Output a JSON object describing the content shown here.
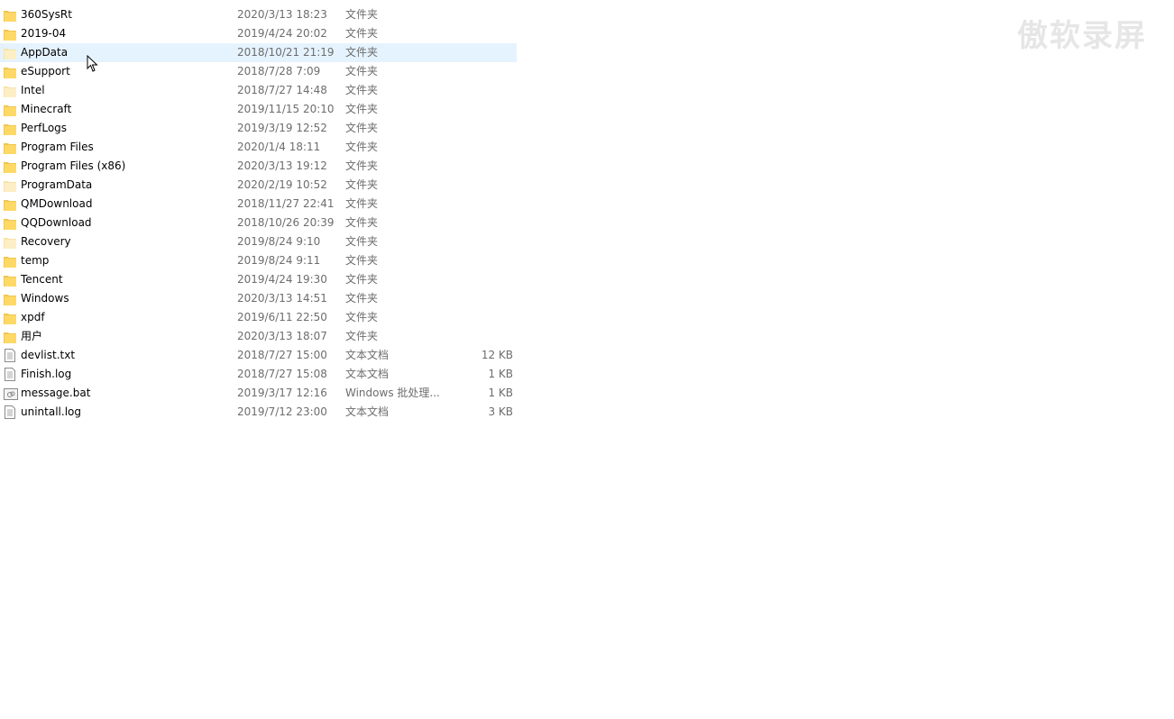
{
  "watermark": "傲软录屏",
  "hover_color": "#e5f3ff",
  "files": [
    {
      "name": "360SysRt",
      "date": "2020/3/13 18:23",
      "type": "文件夹",
      "size": "",
      "icon": "folder-icon"
    },
    {
      "name": "2019-04",
      "date": "2019/4/24 20:02",
      "type": "文件夹",
      "size": "",
      "icon": "folder-icon"
    },
    {
      "name": "AppData",
      "date": "2018/10/21 21:19",
      "type": "文件夹",
      "size": "",
      "icon": "folder-hidden-icon",
      "hover": true
    },
    {
      "name": "eSupport",
      "date": "2018/7/28 7:09",
      "type": "文件夹",
      "size": "",
      "icon": "folder-icon"
    },
    {
      "name": "Intel",
      "date": "2018/7/27 14:48",
      "type": "文件夹",
      "size": "",
      "icon": "folder-hidden-icon"
    },
    {
      "name": "Minecraft",
      "date": "2019/11/15 20:10",
      "type": "文件夹",
      "size": "",
      "icon": "folder-icon"
    },
    {
      "name": "PerfLogs",
      "date": "2019/3/19 12:52",
      "type": "文件夹",
      "size": "",
      "icon": "folder-icon"
    },
    {
      "name": "Program Files",
      "date": "2020/1/4 18:11",
      "type": "文件夹",
      "size": "",
      "icon": "folder-icon"
    },
    {
      "name": "Program Files (x86)",
      "date": "2020/3/13 19:12",
      "type": "文件夹",
      "size": "",
      "icon": "folder-icon"
    },
    {
      "name": "ProgramData",
      "date": "2020/2/19 10:52",
      "type": "文件夹",
      "size": "",
      "icon": "folder-hidden-icon"
    },
    {
      "name": "QMDownload",
      "date": "2018/11/27 22:41",
      "type": "文件夹",
      "size": "",
      "icon": "folder-icon"
    },
    {
      "name": "QQDownload",
      "date": "2018/10/26 20:39",
      "type": "文件夹",
      "size": "",
      "icon": "folder-icon"
    },
    {
      "name": "Recovery",
      "date": "2019/8/24 9:10",
      "type": "文件夹",
      "size": "",
      "icon": "folder-hidden-icon"
    },
    {
      "name": "temp",
      "date": "2019/8/24 9:11",
      "type": "文件夹",
      "size": "",
      "icon": "folder-icon"
    },
    {
      "name": "Tencent",
      "date": "2019/4/24 19:30",
      "type": "文件夹",
      "size": "",
      "icon": "folder-icon"
    },
    {
      "name": "Windows",
      "date": "2020/3/13 14:51",
      "type": "文件夹",
      "size": "",
      "icon": "folder-icon"
    },
    {
      "name": "xpdf",
      "date": "2019/6/11 22:50",
      "type": "文件夹",
      "size": "",
      "icon": "folder-icon"
    },
    {
      "name": "用户",
      "date": "2020/3/13 18:07",
      "type": "文件夹",
      "size": "",
      "icon": "folder-icon"
    },
    {
      "name": "devlist.txt",
      "date": "2018/7/27 15:00",
      "type": "文本文档",
      "size": "12 KB",
      "icon": "text-file-icon"
    },
    {
      "name": "Finish.log",
      "date": "2018/7/27 15:08",
      "type": "文本文档",
      "size": "1 KB",
      "icon": "text-file-icon"
    },
    {
      "name": "message.bat",
      "date": "2019/3/17 12:16",
      "type": "Windows 批处理...",
      "size": "1 KB",
      "icon": "batch-file-icon"
    },
    {
      "name": "unintall.log",
      "date": "2019/7/12 23:00",
      "type": "文本文档",
      "size": "3 KB",
      "icon": "text-file-icon"
    }
  ]
}
